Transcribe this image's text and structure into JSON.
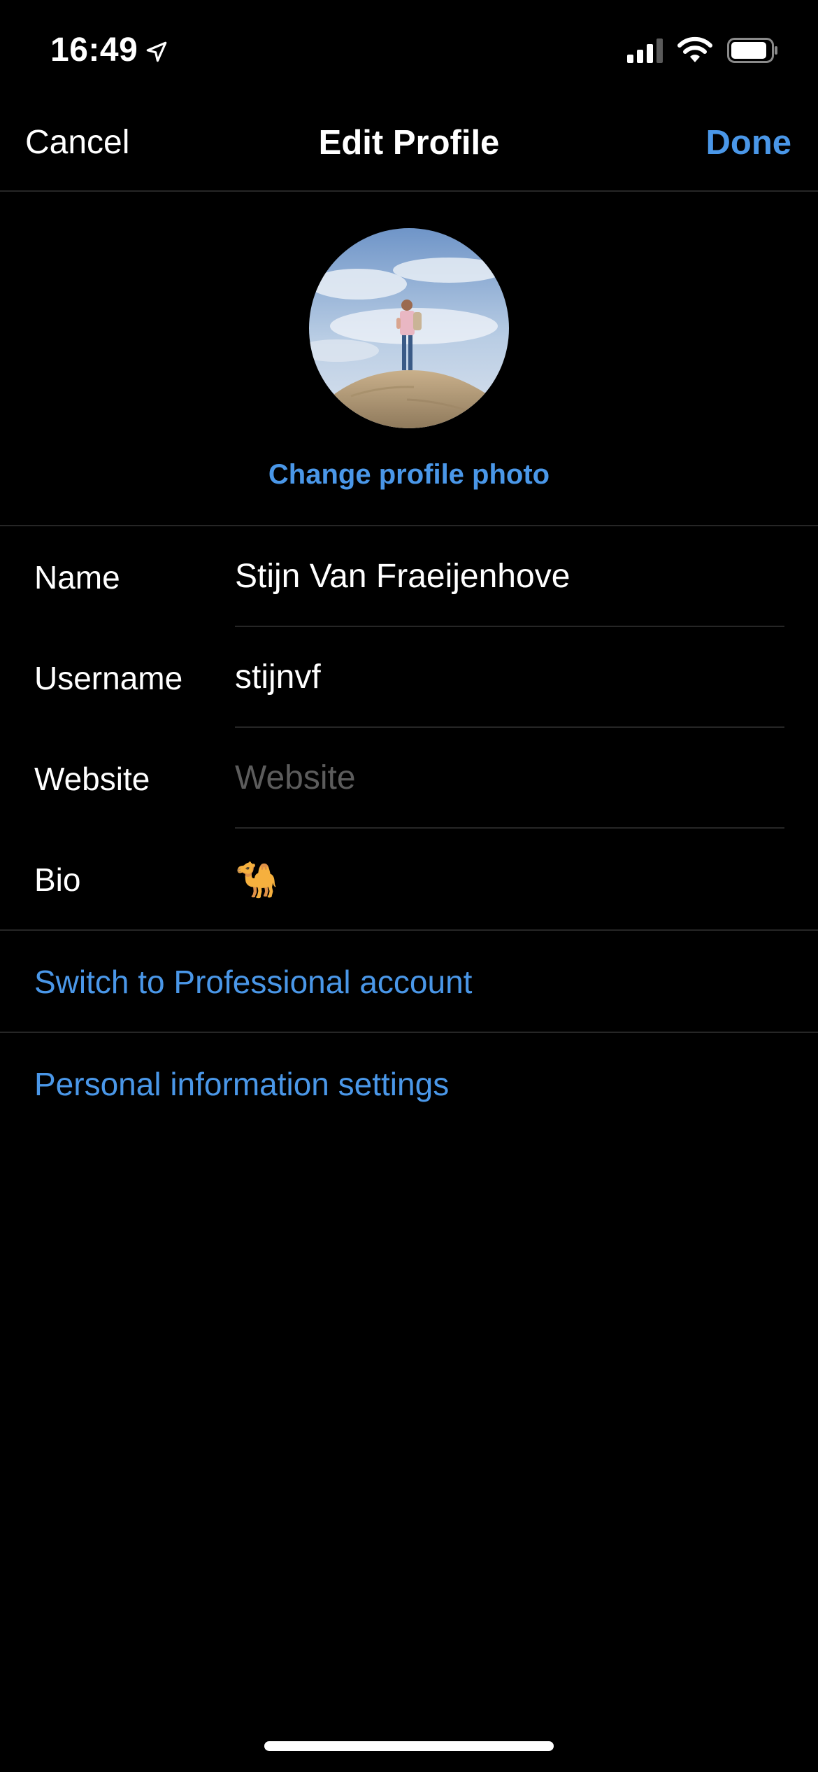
{
  "status_bar": {
    "time": "16:49",
    "icons": [
      "location-arrow-icon",
      "signal-icon",
      "wifi-icon",
      "battery-icon"
    ]
  },
  "nav": {
    "cancel_label": "Cancel",
    "title": "Edit Profile",
    "done_label": "Done"
  },
  "profile": {
    "change_photo_label": "Change profile photo"
  },
  "fields": {
    "name": {
      "label": "Name",
      "value": "Stijn Van Fraeijenhove"
    },
    "username": {
      "label": "Username",
      "value": "stijnvf"
    },
    "website": {
      "label": "Website",
      "value": "",
      "placeholder": "Website"
    },
    "bio": {
      "label": "Bio",
      "value": "🐪"
    }
  },
  "links": {
    "professional": "Switch to Professional account",
    "personal_info": "Personal information settings"
  },
  "colors": {
    "background": "#000000",
    "accent": "#4a97e8",
    "divider": "#262626",
    "placeholder": "#5c5c5c"
  }
}
